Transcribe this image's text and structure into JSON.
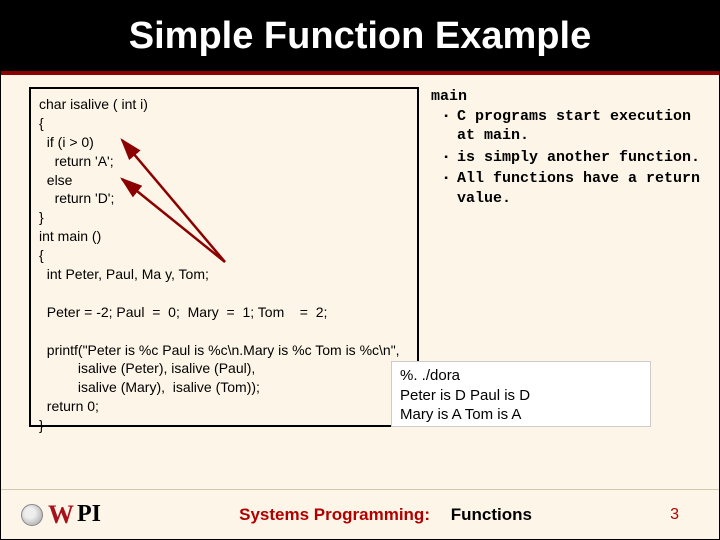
{
  "title": "Simple Function Example",
  "code": {
    "l1": "char isalive ( int i)",
    "l2": "{",
    "l3": "  if (i > 0)",
    "l4": "    return 'A';",
    "l5": "  else",
    "l6": "    return 'D';",
    "l7": "}",
    "l8": "int main ()",
    "l9": "{",
    "l10": "  int Peter, Paul, Ma y, Tom;",
    "l11": " ",
    "l12": "  Peter = -2; Paul  =  0;  Mary  =  1; Tom    =  2;",
    "l13": " ",
    "l14": "  printf(\"Peter is %c Paul is %c\\n.Mary is %c Tom is %c\\n\",",
    "l15": "          isalive (Peter), isalive (Paul),",
    "l16": "          isalive (Mary),  isalive (Tom));",
    "l17": "  return 0;",
    "l18": "}"
  },
  "notes": {
    "heading": "main",
    "b1": "C programs start execution at main.",
    "b2": "is simply another function.",
    "b3": "All functions have a return value."
  },
  "output": {
    "l1": "%. ./dora",
    "l2": "Peter is D Paul is D",
    "l3": "Mary is A Tom is A"
  },
  "footer": {
    "logo_w": "W",
    "logo_pi": "PI",
    "topic": "Systems Programming:",
    "sub": "Functions",
    "page": "3"
  }
}
